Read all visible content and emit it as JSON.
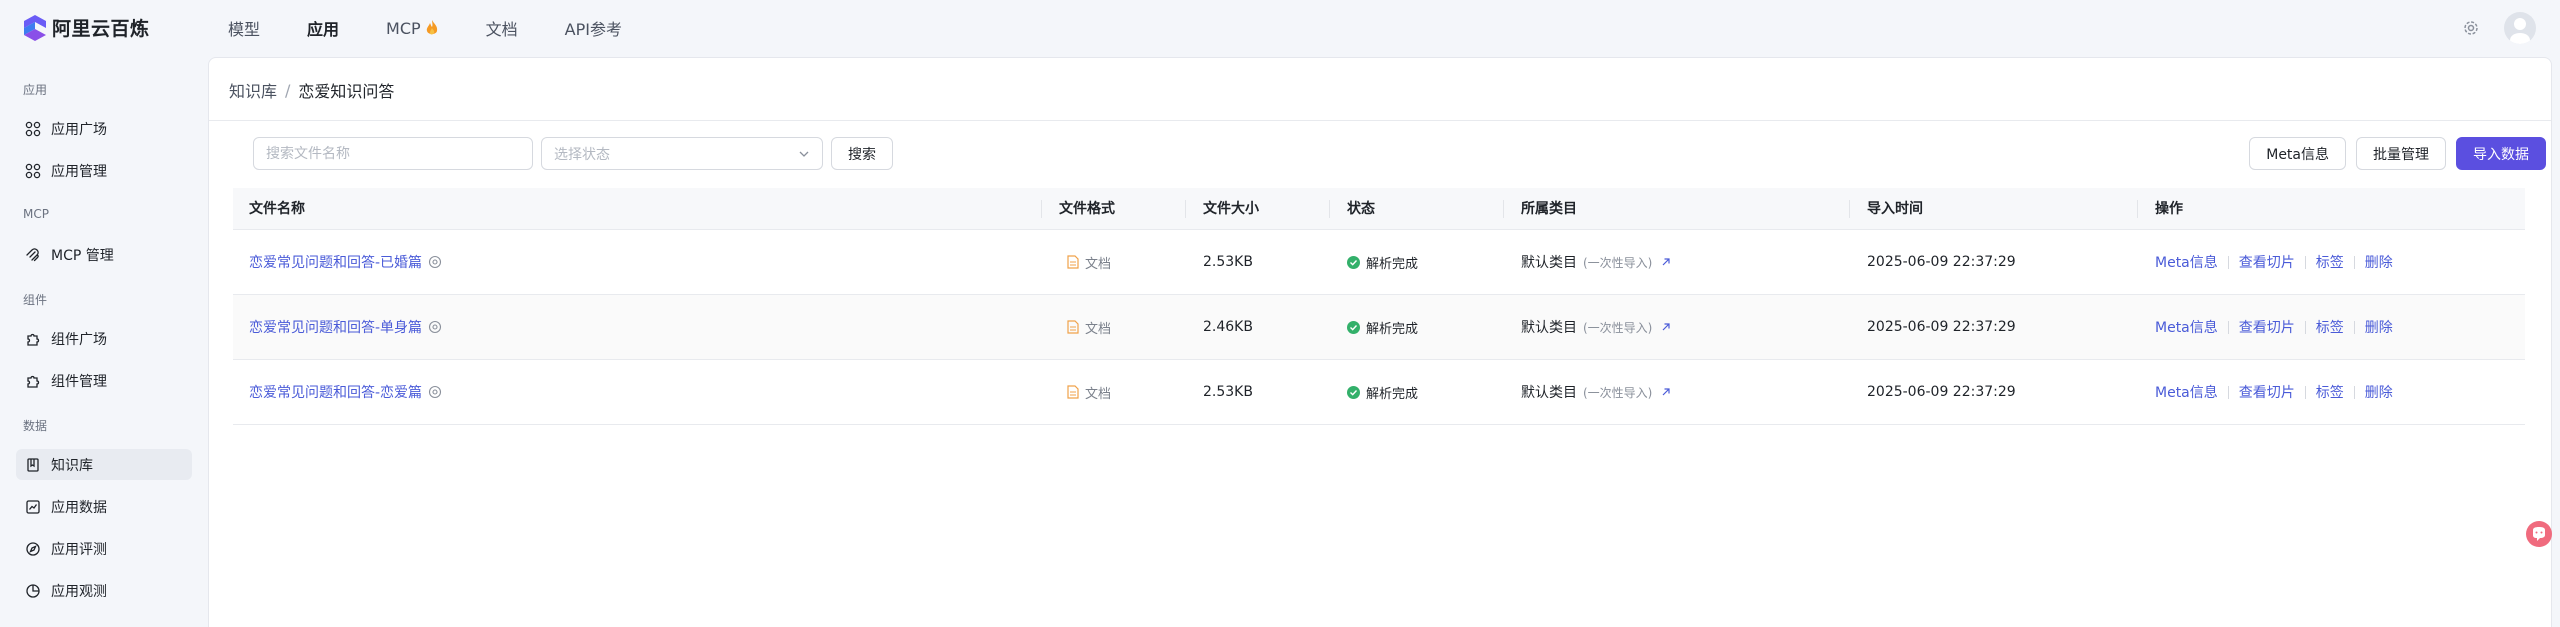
{
  "brand": {
    "name": "阿里云百炼"
  },
  "topnav": {
    "items": [
      {
        "label": "模型",
        "active": false
      },
      {
        "label": "应用",
        "active": true
      },
      {
        "label": "MCP",
        "active": false,
        "icon": "fire-icon"
      },
      {
        "label": "文档",
        "active": false
      },
      {
        "label": "API参考",
        "active": false
      }
    ]
  },
  "sidebar": {
    "groups": [
      {
        "label": "应用"
      },
      {
        "label": "MCP"
      },
      {
        "label": "组件"
      },
      {
        "label": "数据"
      }
    ],
    "items": [
      {
        "label": "应用广场",
        "icon": "grid-icon"
      },
      {
        "label": "应用管理",
        "icon": "grid-icon"
      },
      {
        "label": "MCP 管理",
        "icon": "mcp-icon"
      },
      {
        "label": "组件广场",
        "icon": "puzzle-icon"
      },
      {
        "label": "组件管理",
        "icon": "puzzle-icon"
      },
      {
        "label": "知识库",
        "icon": "book-icon",
        "active": true
      },
      {
        "label": "应用数据",
        "icon": "chart-icon"
      },
      {
        "label": "应用评测",
        "icon": "compass-icon"
      },
      {
        "label": "应用观测",
        "icon": "pie-icon"
      }
    ]
  },
  "breadcrumb": {
    "parent": "知识库",
    "separator": "/",
    "current": "恋爱知识问答"
  },
  "toolbar": {
    "search_placeholder": "搜索文件名称",
    "status_placeholder": "选择状态",
    "search_label": "搜索",
    "meta_label": "Meta信息",
    "batch_label": "批量管理",
    "import_label": "导入数据"
  },
  "table": {
    "columns": [
      "文件名称",
      "文件格式",
      "文件大小",
      "状态",
      "所属类目",
      "导入时间",
      "操作"
    ],
    "rows": [
      {
        "name": "恋爱常见问题和回答-已婚篇",
        "format": "文档",
        "size": "2.53KB",
        "status": "解析完成",
        "category": "默认类目",
        "category_note": "(一次性导入)",
        "time": "2025-06-09 22:37:29"
      },
      {
        "name": "恋爱常见问题和回答-单身篇",
        "format": "文档",
        "size": "2.46KB",
        "status": "解析完成",
        "category": "默认类目",
        "category_note": "(一次性导入)",
        "time": "2025-06-09 22:37:29"
      },
      {
        "name": "恋爱常见问题和回答-恋爱篇",
        "format": "文档",
        "size": "2.53KB",
        "status": "解析完成",
        "category": "默认类目",
        "category_note": "(一次性导入)",
        "time": "2025-06-09 22:37:29"
      }
    ],
    "actions": [
      "Meta信息",
      "查看切片",
      "标签",
      "删除"
    ]
  },
  "colors": {
    "accent": "#5b4fe0",
    "link": "#4a5bd8",
    "success": "#33b06a"
  }
}
